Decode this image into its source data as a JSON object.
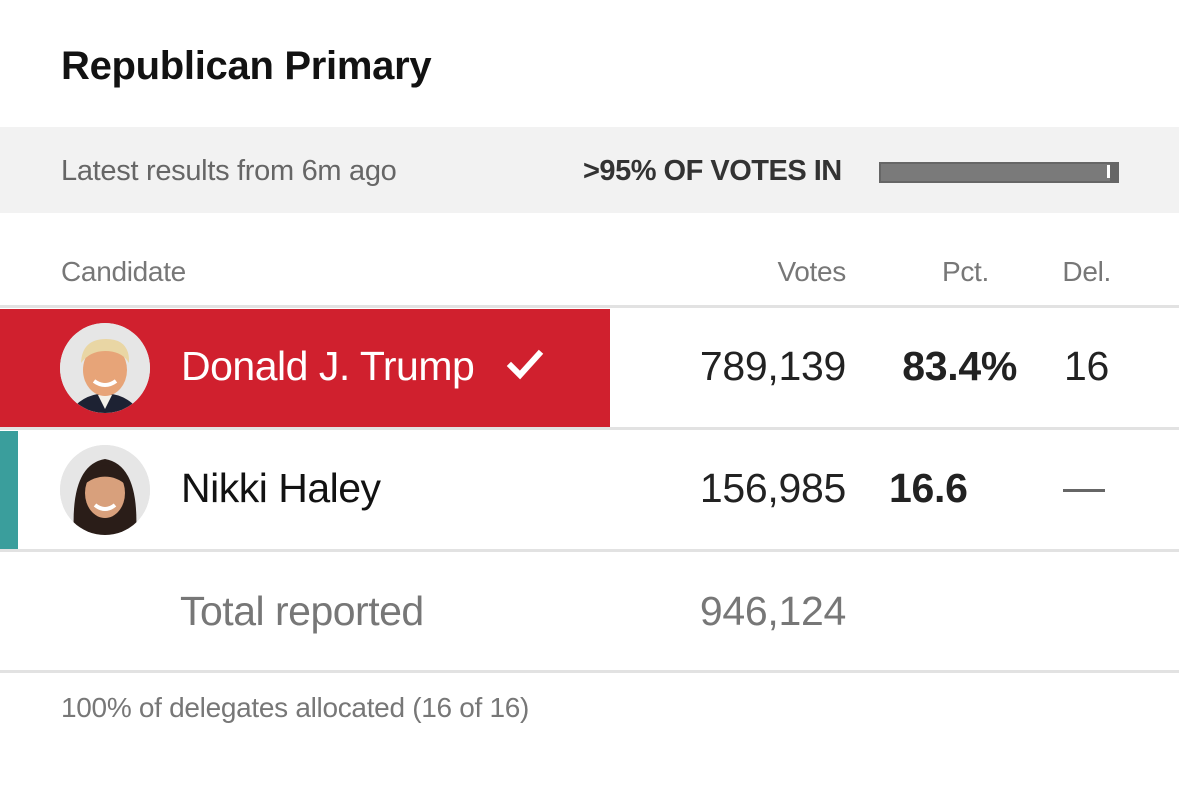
{
  "title": "Republican Primary",
  "status": {
    "latest": "Latest results from 6m ago",
    "votes_in_label": ">95% OF VOTES IN",
    "votes_in_progress_fraction": 0.97
  },
  "table": {
    "headers": {
      "candidate": "Candidate",
      "votes": "Votes",
      "pct": "Pct.",
      "del": "Del."
    },
    "rows": [
      {
        "name": "Donald J. Trump",
        "votes": "789,139",
        "pct": "83.4%",
        "del": "16",
        "winner": true,
        "avatar": "trump-photo",
        "color": "#d0202e"
      },
      {
        "name": "Nikki Haley",
        "votes": "156,985",
        "pct": "16.6",
        "del": "—",
        "winner": false,
        "avatar": "haley-photo",
        "color": "#3a9e9c"
      }
    ],
    "total": {
      "label": "Total reported",
      "votes": "946,124"
    }
  },
  "footer": "100% of delegates allocated (16 of 16)",
  "colors": {
    "republican_red": "#d0202e",
    "haley_teal": "#3a9e9c",
    "status_bg": "#f2f2f2"
  }
}
